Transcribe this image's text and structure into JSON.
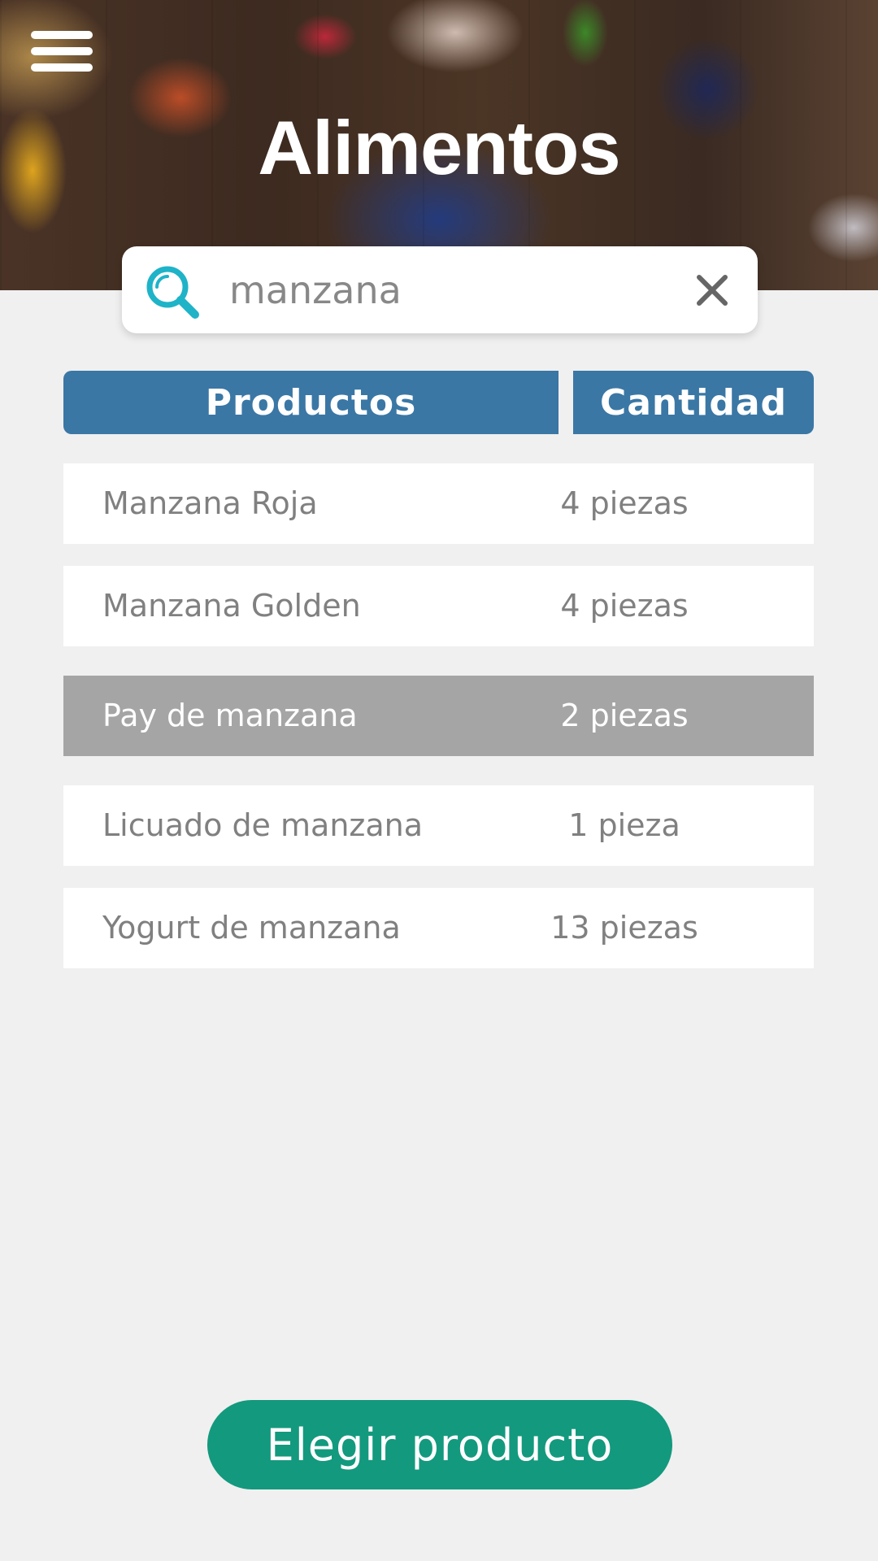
{
  "header": {
    "title": "Alimentos",
    "menu_icon": "hamburger-menu-icon"
  },
  "search": {
    "value": "manzana",
    "search_icon": "search-icon",
    "clear_icon": "close-icon",
    "icon_color": "#1fb3c8"
  },
  "table": {
    "columns": [
      "Productos",
      "Cantidad"
    ],
    "header_color": "#3a77a5",
    "selected_index": 2,
    "rows": [
      {
        "product": "Manzana Roja",
        "quantity": "4 piezas"
      },
      {
        "product": "Manzana Golden",
        "quantity": "4 piezas"
      },
      {
        "product": "Pay de manzana",
        "quantity": "2 piezas"
      },
      {
        "product": "Licuado de manzana",
        "quantity": "1 pieza"
      },
      {
        "product": "Yogurt de manzana",
        "quantity": "13 piezas"
      }
    ]
  },
  "action": {
    "choose_label": "Elegir producto",
    "color": "#13997e"
  }
}
